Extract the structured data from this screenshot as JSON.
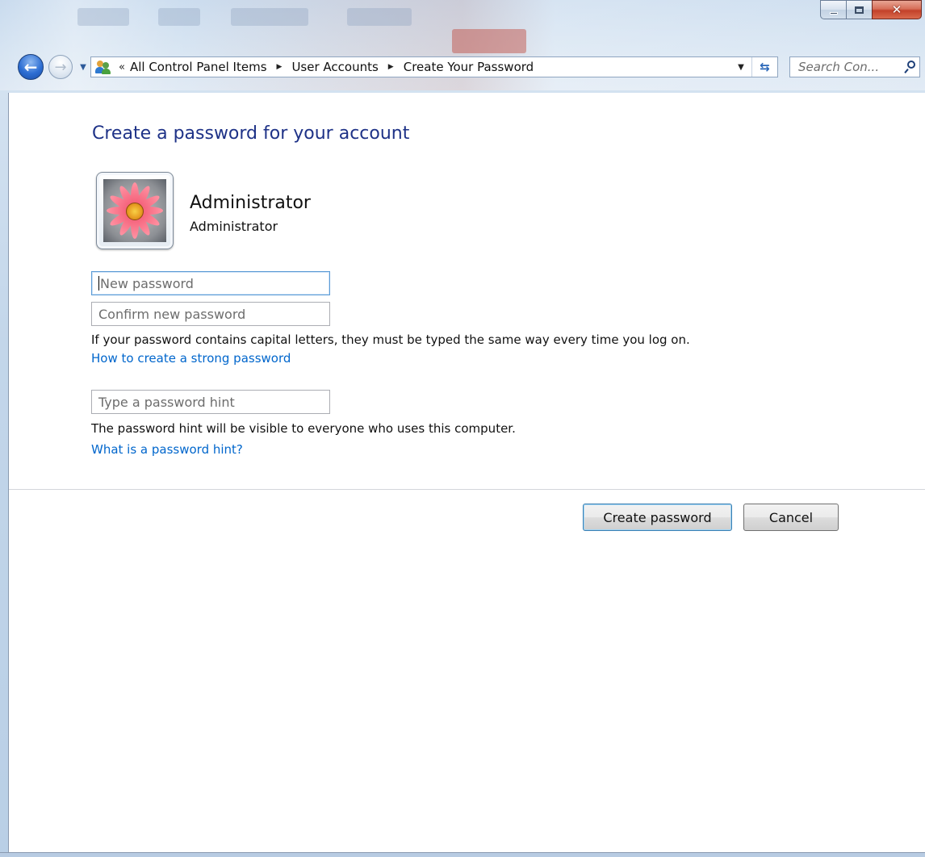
{
  "window": {
    "minimize_glyph": "minimize",
    "maximize_glyph": "maximize",
    "close_glyph": "x"
  },
  "nav": {
    "back_glyph": "←",
    "forward_glyph": "→",
    "overflow_chevron": "«",
    "breadcrumbs": [
      "All Control Panel Items",
      "User Accounts",
      "Create Your Password"
    ],
    "search_placeholder": "Search Con..."
  },
  "page": {
    "title": "Create a password for your account"
  },
  "account": {
    "name": "Administrator",
    "type": "Administrator"
  },
  "form": {
    "new_password_placeholder": "New password",
    "confirm_password_placeholder": "Confirm new password",
    "caps_note": "If your password contains capital letters, they must be typed the same way every time you log on.",
    "strong_password_link": "How to create a strong password",
    "hint_placeholder": "Type a password hint",
    "hint_note": "The password hint will be visible to everyone who uses this computer.",
    "hint_link": "What is a password hint?"
  },
  "actions": {
    "create_label": "Create password",
    "cancel_label": "Cancel"
  },
  "colors": {
    "title_blue": "#1e3287",
    "link_blue": "#0066cc",
    "close_red": "#c3412a"
  }
}
